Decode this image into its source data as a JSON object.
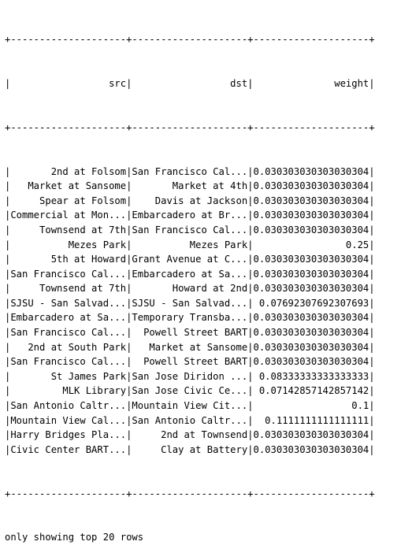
{
  "table": {
    "columns": [
      "src",
      "dst",
      "weight"
    ],
    "widths": [
      20,
      20,
      20
    ],
    "rows": [
      [
        "2nd at Folsom",
        "San Francisco Cal...",
        "0.030303030303030304"
      ],
      [
        "Market at Sansome",
        "Market at 4th",
        "0.030303030303030304"
      ],
      [
        "Spear at Folsom",
        "Davis at Jackson",
        "0.030303030303030304"
      ],
      [
        "Commercial at Mon...",
        "Embarcadero at Br...",
        "0.030303030303030304"
      ],
      [
        "Townsend at 7th",
        "San Francisco Cal...",
        "0.030303030303030304"
      ],
      [
        "Mezes Park",
        "Mezes Park",
        "0.25"
      ],
      [
        "5th at Howard",
        "Grant Avenue at C...",
        "0.030303030303030304"
      ],
      [
        "San Francisco Cal...",
        "Embarcadero at Sa...",
        "0.030303030303030304"
      ],
      [
        "Townsend at 7th",
        "Howard at 2nd",
        "0.030303030303030304"
      ],
      [
        "SJSU - San Salvad...",
        "SJSU - San Salvad...",
        "0.07692307692307693"
      ],
      [
        "Embarcadero at Sa...",
        "Temporary Transba...",
        "0.030303030303030304"
      ],
      [
        "San Francisco Cal...",
        "Powell Street BART",
        "0.030303030303030304"
      ],
      [
        "2nd at South Park",
        "Market at Sansome",
        "0.030303030303030304"
      ],
      [
        "San Francisco Cal...",
        "Powell Street BART",
        "0.030303030303030304"
      ],
      [
        "St James Park",
        "San Jose Diridon ...",
        "0.08333333333333333"
      ],
      [
        "MLK Library",
        "San Jose Civic Ce...",
        "0.07142857142857142"
      ],
      [
        "San Antonio Caltr...",
        "Mountain View Cit...",
        "0.1"
      ],
      [
        "Mountain View Cal...",
        "San Antonio Caltr...",
        "0.1111111111111111"
      ],
      [
        "Harry Bridges Pla...",
        "2nd at Townsend",
        "0.030303030303030304"
      ],
      [
        "Civic Center BART...",
        "Clay at Battery",
        "0.030303030303030304"
      ]
    ],
    "footer": "only showing top 20 rows"
  }
}
